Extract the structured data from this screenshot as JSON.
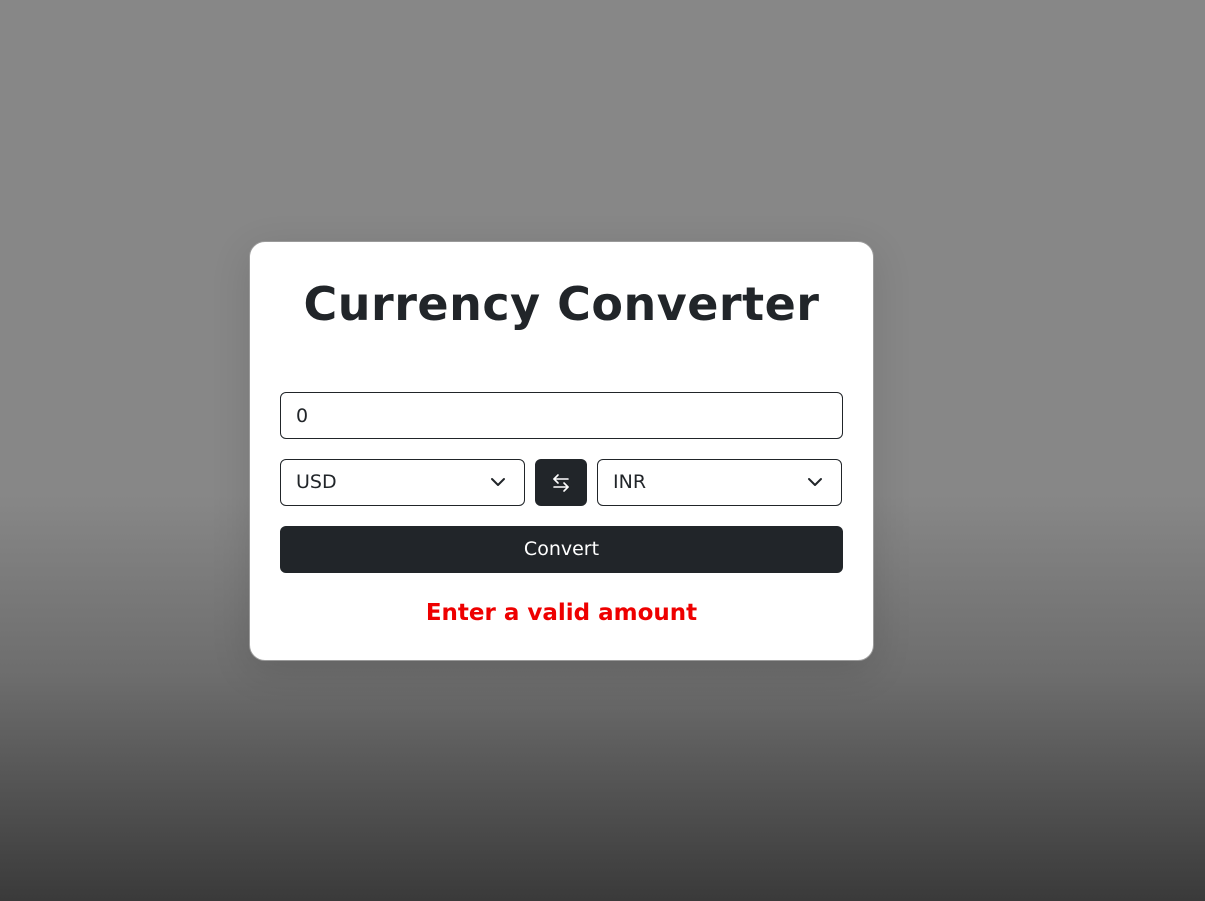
{
  "app": {
    "title": "Currency Converter"
  },
  "amount_input": {
    "value": "0"
  },
  "from_currency": {
    "selected": "USD"
  },
  "to_currency": {
    "selected": "INR"
  },
  "swap_button": {
    "icon": "swap-arrows-icon"
  },
  "convert_button": {
    "label": "Convert"
  },
  "message": {
    "text": "Enter a valid amount",
    "color": "#ee0000"
  },
  "colors": {
    "button_dark": "#212529",
    "card": "#ffffff"
  }
}
